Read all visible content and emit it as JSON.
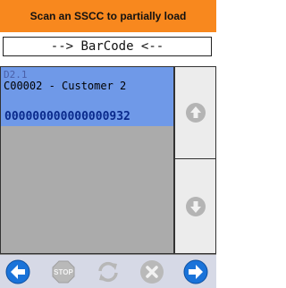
{
  "header": {
    "title": "Scan an SSCC to partially load"
  },
  "barcode": {
    "value": "--> BarCode <--"
  },
  "list": {
    "selected_item": {
      "code": "D2.1",
      "customer": "C00002 - Customer 2",
      "sscc": "000000000000000932"
    }
  },
  "scroll": {
    "up_icon": "arrow-up-icon",
    "down_icon": "arrow-down-icon"
  },
  "toolbar": {
    "back_icon": "arrow-left-icon",
    "stop_label": "STOP",
    "refresh_icon": "refresh-icon",
    "cancel_icon": "close-icon",
    "forward_icon": "arrow-right-icon"
  },
  "colors": {
    "header_bg": "#f8881e",
    "selection_bg": "#6f99e8",
    "list_bg": "#ababab",
    "nav_blue": "#1a73d9"
  }
}
